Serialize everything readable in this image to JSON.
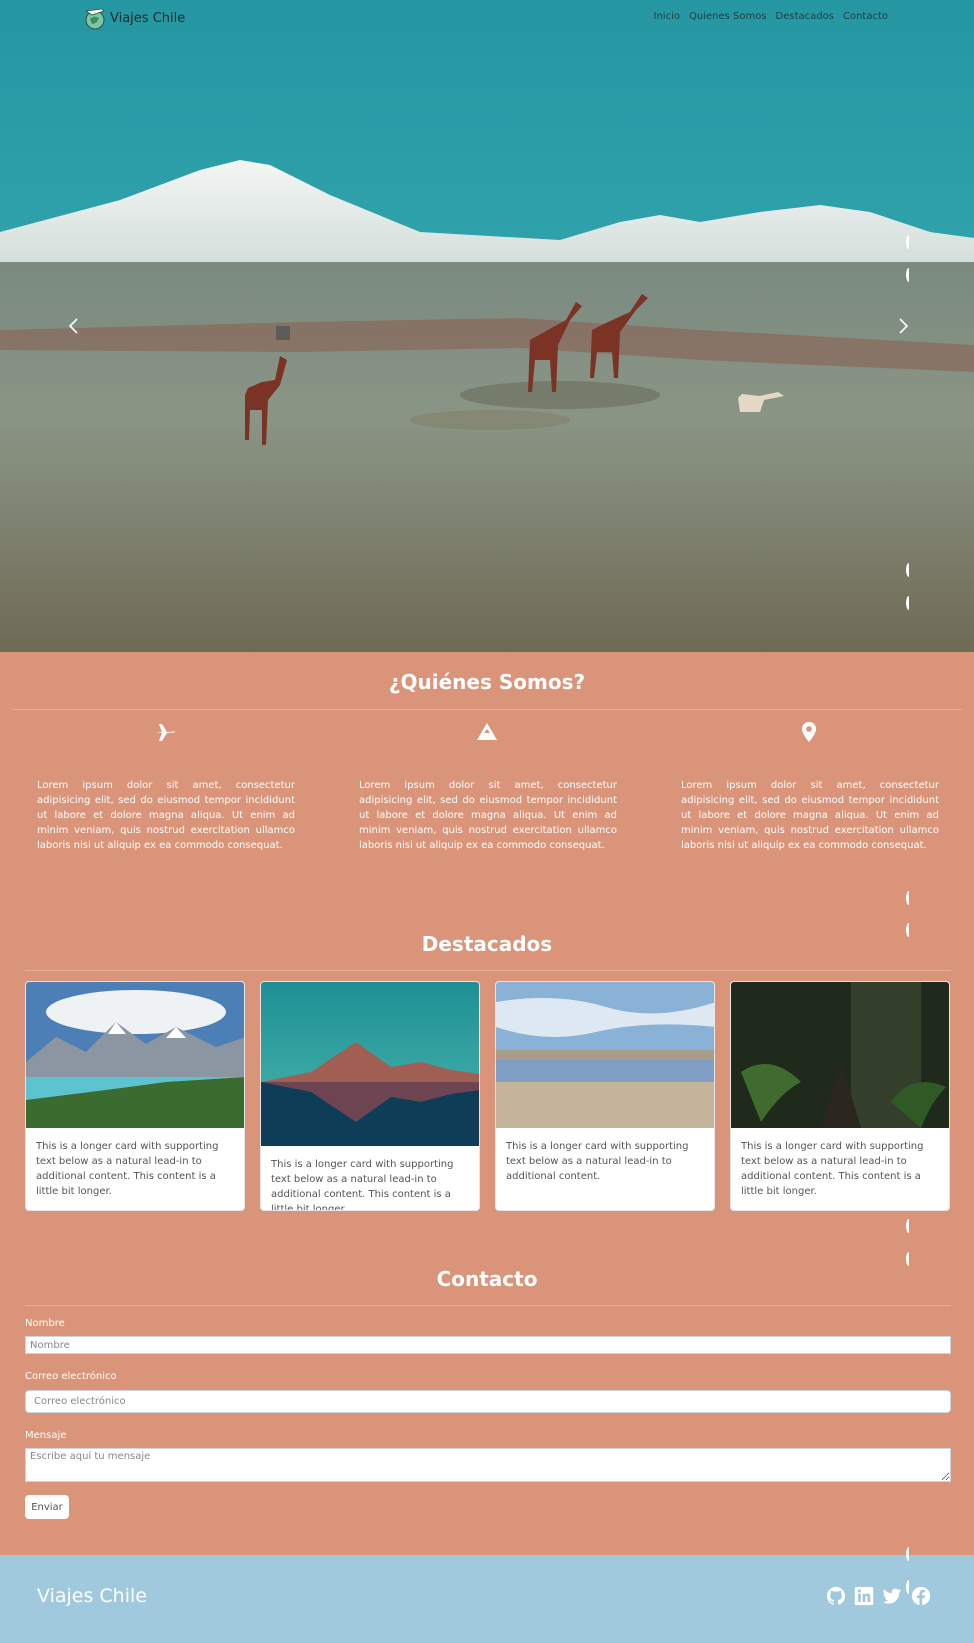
{
  "nav": {
    "brand": "Viajes Chile",
    "links": [
      "Inicio",
      "Quienes Somos",
      "Destacados",
      "Contacto"
    ]
  },
  "about": {
    "title": "¿Quiénes Somos?",
    "columns": [
      {
        "icon": "airplane-icon",
        "text": "Lorem ipsum dolor sit amet, consectetur adipisicing elit, sed do eiusmod tempor incididunt ut labore et dolore magna aliqua. Ut enim ad minim veniam, quis nostrud exercitation ullamco laboris nisi ut aliquip ex ea commodo consequat."
      },
      {
        "icon": "mountain-icon",
        "text": "Lorem ipsum dolor sit amet, consectetur adipisicing elit, sed do eiusmod tempor incididunt ut labore et dolore magna aliqua. Ut enim ad minim veniam, quis nostrud exercitation ullamco laboris nisi ut aliquip ex ea commodo consequat."
      },
      {
        "icon": "location-pin-icon",
        "text": "Lorem ipsum dolor sit amet, consectetur adipisicing elit, sed do eiusmod tempor incididunt ut labore et dolore magna aliqua. Ut enim ad minim veniam, quis nostrud exercitation ullamco laboris nisi ut aliquip ex ea commodo consequat."
      }
    ]
  },
  "featured": {
    "title": "Destacados",
    "cards": [
      {
        "text": "This is a longer card with supporting text below as a natural lead-in to additional content. This content is a little bit longer."
      },
      {
        "text": "This is a longer card with supporting text below as a natural lead-in to additional content. This content is a little bit longer."
      },
      {
        "text": "This is a longer card with supporting text below as a natural lead-in to additional content."
      },
      {
        "text": "This is a longer card with supporting text below as a natural lead-in to additional content. This content is a little bit longer."
      }
    ]
  },
  "contact": {
    "title": "Contacto",
    "name_label": "Nombre",
    "name_placeholder": "Nombre",
    "email_label": "Correo electrónico",
    "email_placeholder": "Correo electrónico",
    "message_label": "Mensaje",
    "message_placeholder": "Escribe aquí tu mensaje",
    "submit_label": "Enviar"
  },
  "footer": {
    "brand": "Viajes Chile",
    "social": [
      "github-icon",
      "linkedin-icon",
      "twitter-icon",
      "facebook-icon"
    ]
  },
  "colors": {
    "accent": "#d99479",
    "footer": "#a1c9dd",
    "sky": "#2a9eaa"
  }
}
